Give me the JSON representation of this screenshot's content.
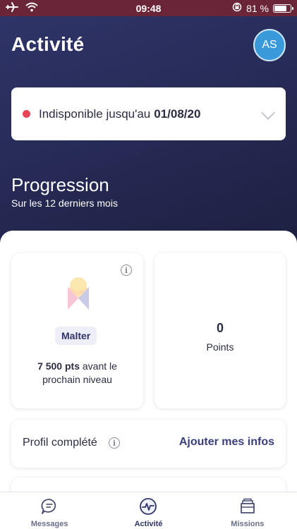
{
  "status_bar": {
    "time": "09:48",
    "battery": "81 %",
    "battery_level": 0.81,
    "icons": [
      "airplane-icon",
      "wifi-icon",
      "orientation-lock-icon",
      "battery-icon"
    ]
  },
  "header": {
    "title": "Activité",
    "avatar_initials": "AS"
  },
  "availability": {
    "label": "Indisponible jusqu'au",
    "date": "01/08/20",
    "dot_color": "#e8445a"
  },
  "progression": {
    "title": "Progression",
    "subtitle": "Sur les 12 derniers mois"
  },
  "level_card": {
    "level_name": "Malter",
    "points_value": "7 500 pts",
    "points_suffix": "avant le prochain niveau"
  },
  "points_card": {
    "value": "0",
    "label": "Points"
  },
  "profile": {
    "label": "Profil complété",
    "action": "Ajouter mes infos"
  },
  "tabs": [
    {
      "label": "Messages",
      "icon": "chat-bubble-icon",
      "active": false
    },
    {
      "label": "Activité",
      "icon": "activity-pulse-icon",
      "active": true
    },
    {
      "label": "Missions",
      "icon": "folder-icon",
      "active": false
    }
  ],
  "colors": {
    "brand_dark": "#2f3468",
    "status_bar": "#6b2538",
    "accent_blue": "#3a9ad9",
    "tab_active": "#2f3468",
    "tab_inactive": "#6b6e8a"
  }
}
